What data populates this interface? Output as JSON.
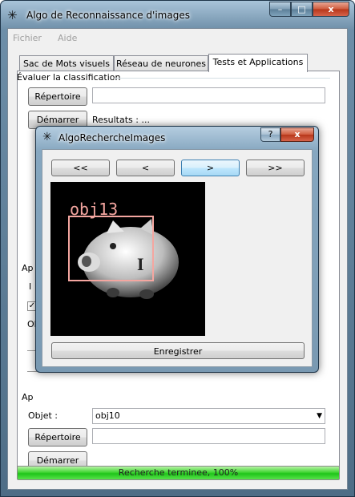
{
  "window": {
    "title": "Algo de Reconnaissance d'images",
    "caption": {
      "minimize": "–",
      "maximize": "□",
      "close": "x"
    }
  },
  "menu": [
    "Fichier",
    "Aide"
  ],
  "tabs": [
    "Sac de Mots visuels",
    "Réseau de neurones",
    "Tests et Applications"
  ],
  "active_tab": 2,
  "evaluate": {
    "title": "Évaluer la classification",
    "folder_button": "Répertoire",
    "folder_value": "",
    "start_button": "Démarrer",
    "results_label": "Resultats : ..."
  },
  "obscured": {
    "group_a_label": "Ap",
    "button_stub": "I",
    "obj_label": "Obj"
  },
  "apply": {
    "title": "Ap",
    "object_label": "Objet :",
    "object_value": "obj10",
    "folder_button": "Répertoire",
    "folder_value": "",
    "start_button": "Démarrer"
  },
  "status": {
    "text": "Recherche terminee, 100%",
    "progress": 1.0
  },
  "dialog": {
    "title": "AlgoRechercheImages",
    "help": "?",
    "close": "x",
    "nav": [
      "<<",
      "<",
      ">",
      ">>"
    ],
    "focused_nav": 2,
    "detection_label": "obj13",
    "detection_color": "#f4a6a0",
    "save_button": "Enregistrer"
  },
  "icons": {
    "app": "network-icon",
    "dialog": "network-icon"
  }
}
